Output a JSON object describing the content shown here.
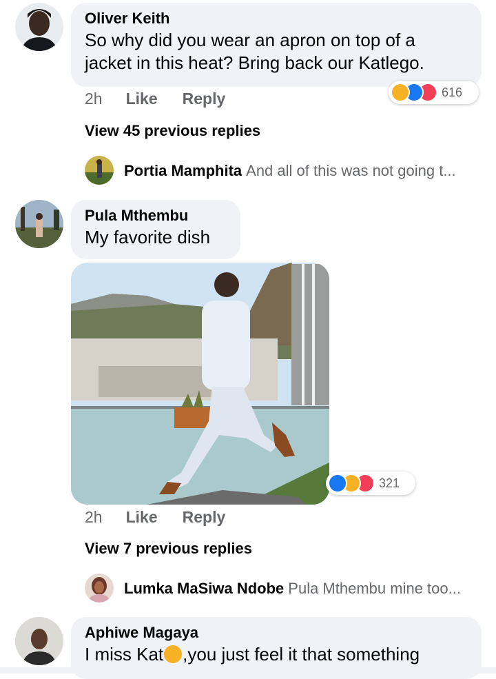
{
  "comments": [
    {
      "author": "Oliver Keith",
      "text_line1": "So why did you wear an apron on top of a",
      "text_line2": "jacket in this heat? Bring back our Katlego.",
      "time": "2h",
      "like": "Like",
      "reply": "Reply",
      "reaction_count": "616",
      "view_replies": "View 45 previous replies",
      "latest_reply": {
        "author": "Portia Mamphita",
        "text": "And all of this was not going t..."
      }
    },
    {
      "author": "Pula Mthembu",
      "text": "My favorite dish",
      "time": "2h",
      "like": "Like",
      "reply": "Reply",
      "reaction_count": "321",
      "view_replies": "View 7 previous replies",
      "latest_reply": {
        "author": "Lumka MaSiwa Ndobe",
        "text": "Pula Mthembu mine too..."
      }
    },
    {
      "author": "Aphiwe Magaya",
      "text_before_emoji": "I miss Kat",
      "text_after_emoji": ",you just feel it that something"
    }
  ],
  "icons": [
    "haha-reaction-icon",
    "like-reaction-icon",
    "love-reaction-icon",
    "sad-emoji-icon"
  ],
  "colors": {
    "bubble": "#f0f2f5",
    "secondary_text": "#65676b",
    "like_blue": "#1877f2",
    "love_red": "#f33e58",
    "haha_yellow": "#f7b125"
  }
}
